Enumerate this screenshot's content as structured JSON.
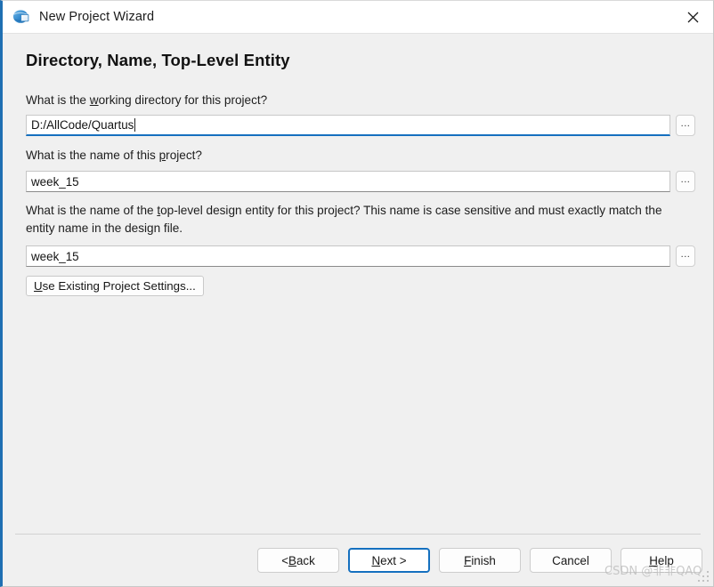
{
  "window": {
    "title": "New Project Wizard",
    "icon": "globe-icon",
    "close_label": "✕",
    "accent_color": "#1570bf",
    "border_color": "#1f6fb2",
    "background_color": "#f0f0f0"
  },
  "page": {
    "heading": "Directory, Name, Top-Level Entity"
  },
  "fields": [
    {
      "name": "working-directory",
      "question_pre": "What is the ",
      "question_mnemonic": "w",
      "question_post": "orking directory for this project?",
      "value": "D:/AllCode/Quartus",
      "focused": true,
      "browse_label": "..."
    },
    {
      "name": "project-name",
      "question_pre": "What is the name of this ",
      "question_mnemonic": "p",
      "question_post": "roject?",
      "value": "week_15",
      "focused": false,
      "browse_label": "..."
    },
    {
      "name": "top-level-entity",
      "question_pre": "What is the name of the ",
      "question_mnemonic": "t",
      "question_post": "op-level design entity for this project? This name is case sensitive and must exactly match the entity name in the design file.",
      "value": "week_15",
      "focused": false,
      "browse_label": "..."
    }
  ],
  "settings_button": {
    "mnemonic": "U",
    "label_rest": "se Existing Project Settings..."
  },
  "footer": {
    "buttons": [
      {
        "name": "back-button",
        "label": "< Back",
        "mnemonic": "B",
        "pre": "< ",
        "post": "ack",
        "default": false
      },
      {
        "name": "next-button",
        "label": "Next >",
        "mnemonic": "N",
        "pre": "",
        "post": "ext >",
        "default": true
      },
      {
        "name": "finish-button",
        "label": "Finish",
        "mnemonic": "F",
        "pre": "",
        "post": "inish",
        "default": false
      },
      {
        "name": "cancel-button",
        "label": "Cancel",
        "mnemonic": "",
        "pre": "Cancel",
        "post": "",
        "default": false
      },
      {
        "name": "help-button",
        "label": "Help",
        "mnemonic": "H",
        "pre": "",
        "post": "elp",
        "default": false
      }
    ]
  },
  "watermark": {
    "text": "CSDN @非非QAQ"
  }
}
